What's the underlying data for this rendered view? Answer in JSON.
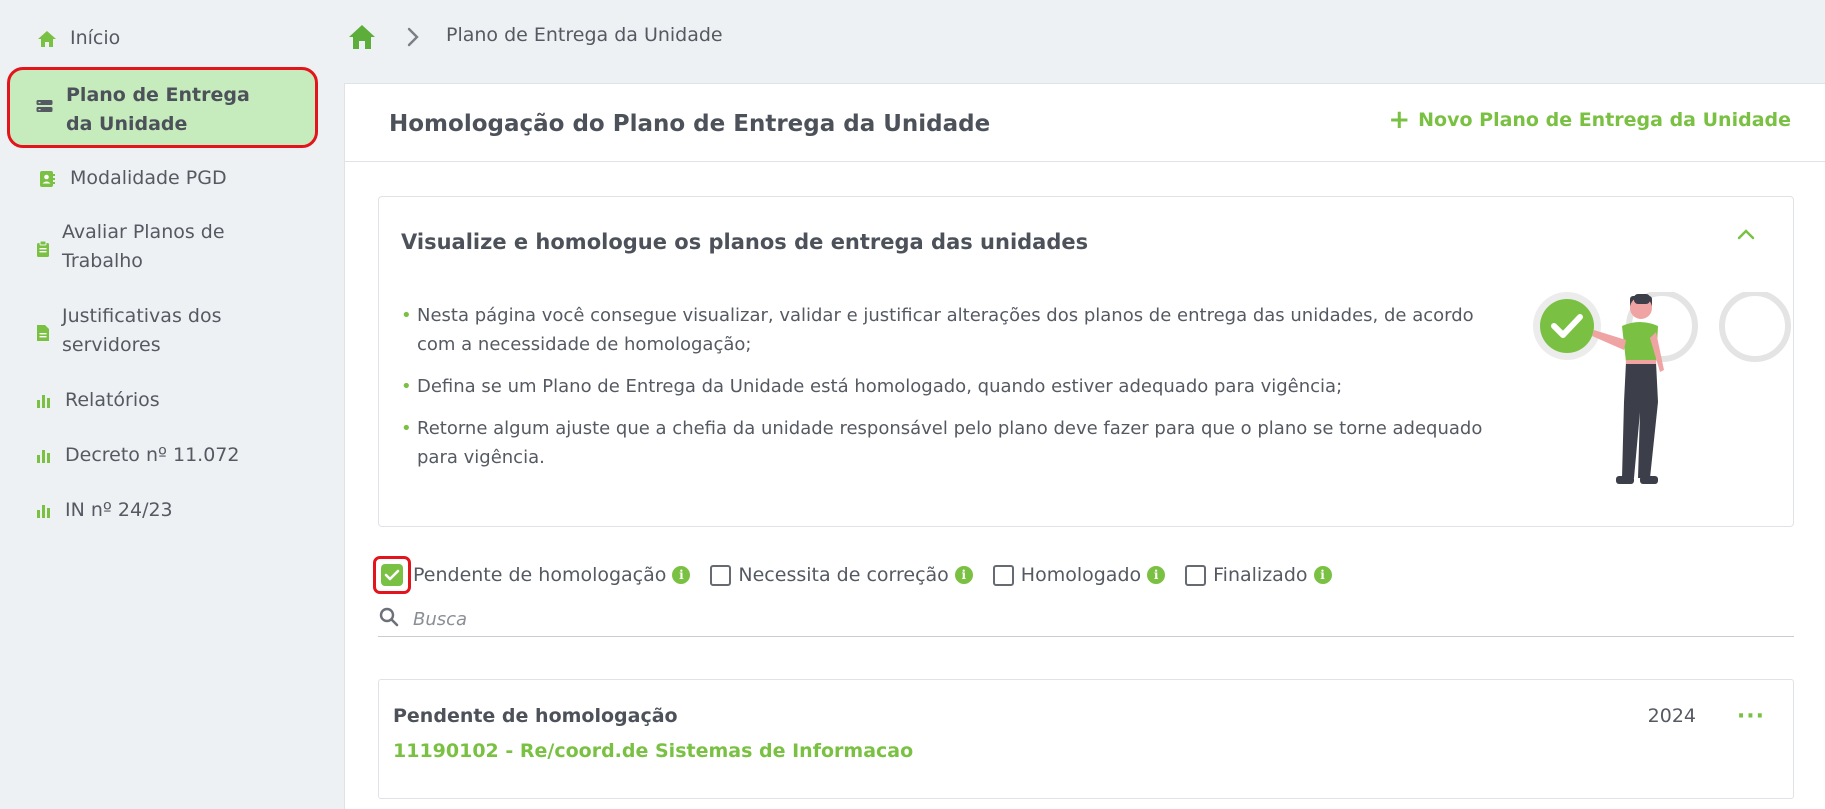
{
  "sidebar": {
    "items": [
      {
        "label": "Início",
        "icon": "home-icon"
      },
      {
        "label": "Plano de Entrega da Unidade",
        "icon": "server-icon",
        "active": true
      },
      {
        "label": "Modalidade PGD",
        "icon": "contact-book-icon"
      },
      {
        "label": "Avaliar Planos de Trabalho",
        "icon": "clipboard-icon"
      },
      {
        "label": "Justificativas dos servidores",
        "icon": "document-icon"
      },
      {
        "label": "Relatórios",
        "icon": "bar-chart-icon"
      },
      {
        "label": "Decreto nº 11.072",
        "icon": "bar-chart-icon"
      },
      {
        "label": "IN nº 24/23",
        "icon": "bar-chart-icon"
      }
    ]
  },
  "breadcrumb": {
    "current": "Plano de Entrega da Unidade"
  },
  "header": {
    "title": "Homologação do Plano de Entrega da Unidade",
    "new_button": "Novo Plano de Entrega da Unidade"
  },
  "info": {
    "title": "Visualize e homologue os planos de entrega das unidades",
    "bullets": [
      "Nesta página você consegue visualizar, validar e justificar alterações dos planos de entrega das unidades, de acordo com a necessidade de homologação;",
      "Defina se um Plano de Entrega da Unidade está homologado, quando estiver adequado para vigência;",
      "Retorne algum ajuste que a chefia da unidade responsável pelo plano deve fazer para que o plano se torne adequado para vigência."
    ]
  },
  "filters": [
    {
      "label": "Pendente de homologação",
      "checked": true
    },
    {
      "label": "Necessita de correção",
      "checked": false
    },
    {
      "label": "Homologado",
      "checked": false
    },
    {
      "label": "Finalizado",
      "checked": false
    }
  ],
  "search": {
    "placeholder": "Busca"
  },
  "results": [
    {
      "status": "Pendente de homologação",
      "unit": "11190102 - Re/coord.de Sistemas de Informacao",
      "year": "2024",
      "more": "···"
    }
  ],
  "colors": {
    "accent": "#7ac143",
    "active_bg": "#c6ecbe",
    "highlight": "#e3141b",
    "background": "#eef1f4"
  }
}
